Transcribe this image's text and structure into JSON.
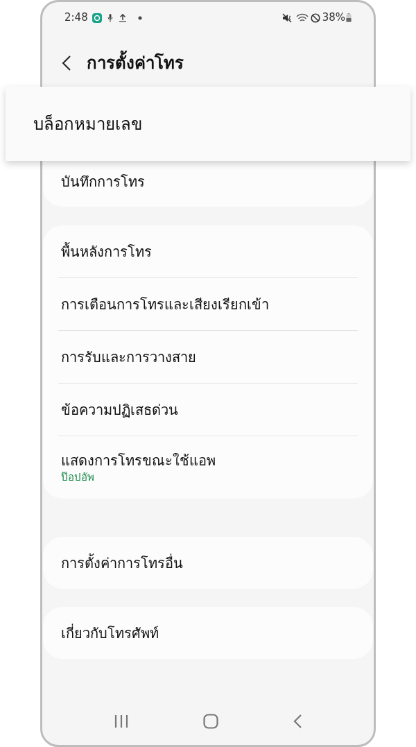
{
  "status_bar": {
    "time": "2:48",
    "battery": "38%"
  },
  "header": {
    "title": "การตั้งค่าโทร"
  },
  "popup": {
    "label": "บล็อกหมายเลข"
  },
  "groups": [
    {
      "items": [
        {
          "label": "บันทึกการโทร"
        }
      ]
    },
    {
      "items": [
        {
          "label": "พื้นหลังการโทร"
        },
        {
          "label": "การเตือนการโทรและเสียงเรียกเข้า"
        },
        {
          "label": "การรับและการวางสาย"
        },
        {
          "label": "ข้อความปฏิเสธด่วน"
        },
        {
          "label": "แสดงการโทรขณะใช้แอพ",
          "subtitle": "ป๊อปอัพ"
        }
      ]
    },
    {
      "items": [
        {
          "label": "การตั้งค่าการโทรอื่น"
        }
      ]
    },
    {
      "items": [
        {
          "label": "เกี่ยวกับโทรศัพท์"
        }
      ]
    }
  ]
}
